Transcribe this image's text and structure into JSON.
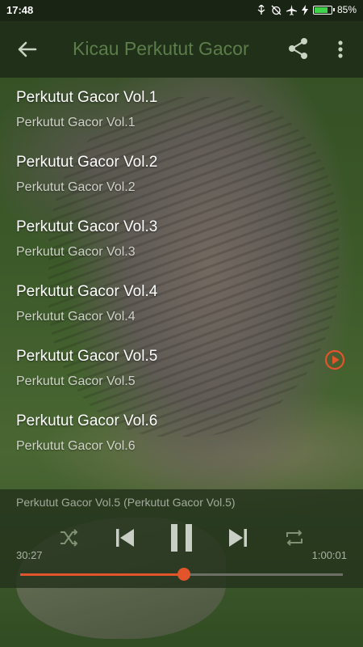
{
  "status_bar": {
    "time": "17:48",
    "battery_text": "85%",
    "battery_level": 0.85,
    "icons": [
      "usb-icon",
      "alarm-off-icon",
      "airplane-icon",
      "charging-icon",
      "battery-icon"
    ]
  },
  "toolbar": {
    "title": "Kicau Perkutut Gacor",
    "back_icon": "arrow-left-icon",
    "share_icon": "share-icon",
    "more_icon": "more-vert-icon"
  },
  "tracks": [
    {
      "title": "Perkutut Gacor Vol.1",
      "subtitle": "Perkutut Gacor Vol.1",
      "playing": false
    },
    {
      "title": "Perkutut Gacor Vol.2",
      "subtitle": "Perkutut Gacor Vol.2",
      "playing": false
    },
    {
      "title": "Perkutut Gacor Vol.3",
      "subtitle": "Perkutut Gacor Vol.3",
      "playing": false
    },
    {
      "title": "Perkutut Gacor Vol.4",
      "subtitle": "Perkutut Gacor Vol.4",
      "playing": false
    },
    {
      "title": "Perkutut Gacor Vol.5",
      "subtitle": "Perkutut Gacor Vol.5",
      "playing": true
    },
    {
      "title": "Perkutut Gacor Vol.6",
      "subtitle": "Perkutut Gacor Vol.6",
      "playing": false
    }
  ],
  "player": {
    "now_playing": "Perkutut Gacor Vol.5 (Perkutut Gacor Vol.5)",
    "current_time": "30:27",
    "duration": "1:00:01",
    "progress": 0.507,
    "controls": [
      "shuffle-icon",
      "skip-previous-icon",
      "pause-icon",
      "skip-next-icon",
      "repeat-icon"
    ]
  },
  "colors": {
    "accent": "#e2552b",
    "toolbar_bg": "#213019",
    "title_text": "#5c7d49"
  }
}
